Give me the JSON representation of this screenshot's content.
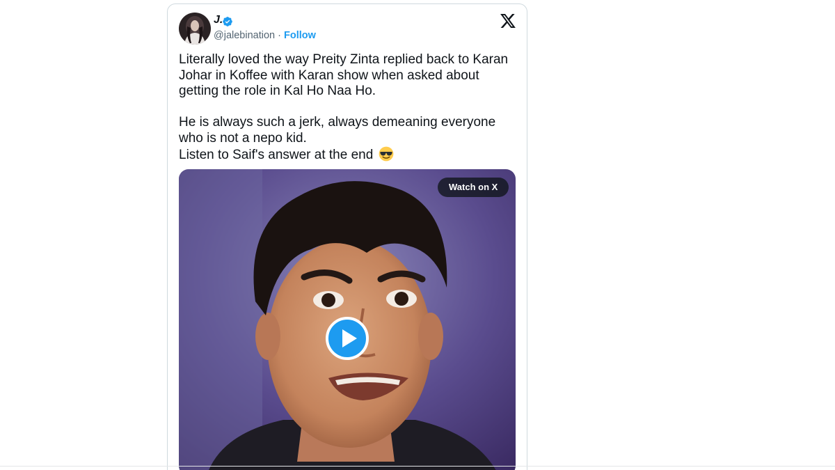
{
  "tweet": {
    "display_name": "J.",
    "verified": true,
    "handle": "@jalebination",
    "separator": " · ",
    "follow_label": "Follow",
    "platform_icon": "x-logo-icon",
    "text_paragraph_1": "Literally loved the way Preity Zinta replied back to Karan Johar in Koffee with Karan show when asked about getting the role in Kal Ho Naa Ho.",
    "text_line_2a": "He is always such a jerk, always demeaning everyone who is not a nepo kid.",
    "text_line_2b": "Listen to Saif's answer at the end",
    "text_emoji": "smiling-face-with-sunglasses-icon"
  },
  "media": {
    "watch_label": "Watch on X",
    "play_icon": "play-icon",
    "colors": {
      "play_fill": "#1d9bf0",
      "background": "#5b4a8c",
      "skin": "#c98a66",
      "hair": "#1a1210"
    }
  },
  "colors": {
    "accent": "#1d9bf0",
    "text": "#0f1419",
    "muted": "#536471",
    "border": "#cfd9de"
  }
}
